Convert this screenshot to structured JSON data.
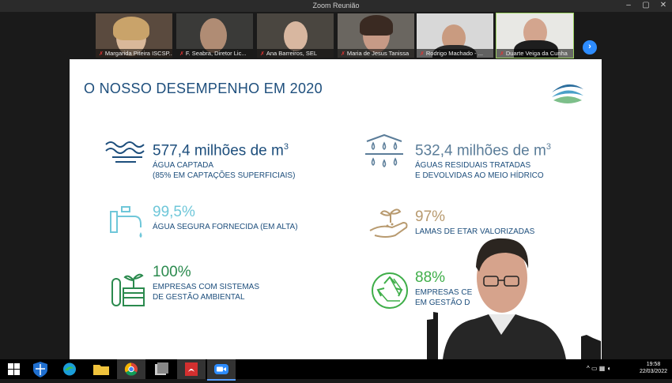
{
  "window": {
    "title": "Zoom Reunião"
  },
  "participants": [
    {
      "name": "Margarida Piteira ISCSP..."
    },
    {
      "name": "F. Seabra, Diretor Lic..."
    },
    {
      "name": "Ana Barreiros, SEL"
    },
    {
      "name": "Maria de Jesus Tanissa"
    },
    {
      "name": "Rodrigo Machado - ..."
    },
    {
      "name": "Duarte Veiga da Cunha"
    }
  ],
  "slide": {
    "title": "O NOSSO DESEMPENHO EM 2020",
    "stats": [
      {
        "value": "577,4 milhões de m",
        "sup": "3",
        "desc1": "ÁGUA CAPTADA",
        "desc2": "(85% EM CAPTAÇÕES SUPERFICIAIS)",
        "icon": "waves-icon",
        "color": "#1d4e7c"
      },
      {
        "value": "532,4 milhões de m",
        "sup": "3",
        "desc1": "ÁGUAS RESIDUAIS TRATADAS",
        "desc2": "E DEVOLVIDAS AO MEIO HÍDRICO",
        "icon": "water-treatment-icon",
        "color": "#5b7d99"
      },
      {
        "value": "99,5%",
        "desc1": "ÁGUA SEGURA FORNECIDA (EM ALTA)",
        "icon": "tap-icon",
        "color": "#6fc7d9"
      },
      {
        "value": "97%",
        "desc1": "LAMAS DE ETAR VALORIZADAS",
        "icon": "hand-plant-icon",
        "color": "#b89a6f"
      },
      {
        "value": "100%",
        "desc1": "EMPRESAS COM SISTEMAS",
        "desc2": "DE GESTÃO AMBIENTAL",
        "icon": "plant-test-tube-icon",
        "color": "#2b8a4e"
      },
      {
        "value": "88%",
        "desc1": "EMPRESAS CE",
        "desc2": "EM GESTÃO D",
        "icon": "recycle-icon",
        "color": "#3fae49"
      }
    ]
  },
  "taskbar": {
    "time": "19:58",
    "date": "22/03/2022"
  }
}
